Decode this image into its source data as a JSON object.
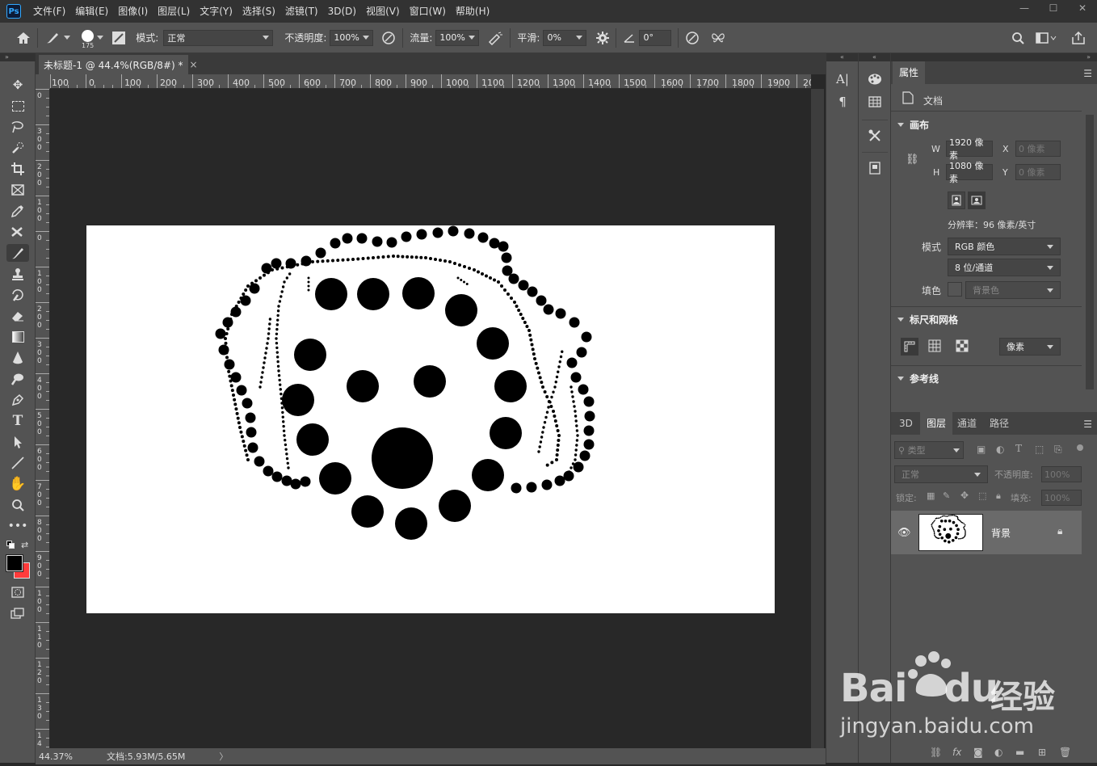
{
  "app": {
    "logo": "Ps"
  },
  "menu": [
    "文件(F)",
    "编辑(E)",
    "图像(I)",
    "图层(L)",
    "文字(Y)",
    "选择(S)",
    "滤镜(T)",
    "3D(D)",
    "视图(V)",
    "窗口(W)",
    "帮助(H)"
  ],
  "window_controls": [
    "—",
    "☐",
    "✕"
  ],
  "options": {
    "brush_size": "175",
    "mode_label": "模式:",
    "mode_value": "正常",
    "opacity_label": "不透明度:",
    "opacity_value": "100%",
    "flow_label": "流量:",
    "flow_value": "100%",
    "smooth_label": "平滑:",
    "smooth_value": "0%",
    "angle_value": "0°"
  },
  "document_tab": {
    "title": "未标题-1 @ 44.4%(RGB/8#) *",
    "close": "×"
  },
  "ruler": {
    "h": [
      "100",
      "0",
      "100",
      "200",
      "300",
      "400",
      "500",
      "600",
      "700",
      "800",
      "900",
      "1000",
      "1100",
      "1200",
      "1300",
      "1400",
      "1500",
      "1600",
      "1700",
      "1800",
      "1900",
      "20"
    ],
    "v": [
      "0",
      "3 0 0",
      "2 0 0",
      "1 0 0",
      "0",
      "1 0 0",
      "2 0 0",
      "3 0 0",
      "4 0 0",
      "5 0 0",
      "6 0 0",
      "7 0 0",
      "8 0 0",
      "9 0 0",
      "1 0 0",
      "1 1 0",
      "1 2 0",
      "1 3 0",
      "1 4"
    ]
  },
  "status": {
    "zoom": "44.37%",
    "doc_info": "文档:5.93M/5.65M",
    "arrow": "〉"
  },
  "panels": {
    "mini1_icons": [
      "character-icon",
      "paragraph-icon"
    ],
    "mini2_icons": [
      "color-palette-icon",
      "table-icon",
      "tools-icon",
      "book-icon"
    ]
  },
  "properties": {
    "tab": "属性",
    "doc_label": "文档",
    "canvas_title": "画布",
    "w_label": "W",
    "w_value": "1920 像素",
    "h_label": "H",
    "h_value": "1080 像素",
    "x_label": "X",
    "x_value": "0 像素",
    "y_label": "Y",
    "y_value": "0 像素",
    "resolution": "分辨率：96 像素/英寸",
    "mode_label": "模式",
    "mode_value": "RGB 颜色",
    "depth_value": "8 位/通道",
    "fill_label": "填色",
    "fill_value": "背景色",
    "rulers_title": "标尺和网格",
    "units_value": "像素",
    "guides_title": "参考线"
  },
  "layers": {
    "tabs": [
      "3D",
      "图层",
      "通道",
      "路径"
    ],
    "active_tab": "图层",
    "filter_value": "类型",
    "blend_value": "正常",
    "opacity_label": "不透明度:",
    "opacity_value": "100%",
    "lock_label": "锁定:",
    "fill_label": "填充:",
    "fill_value": "100%",
    "items": [
      {
        "name": "背景",
        "locked": true,
        "visible": true
      }
    ]
  },
  "watermark": {
    "brand": "Bai",
    "brand_suffix": "du",
    "cn": "经验",
    "url": "jingyan.baidu.com"
  },
  "colors": {
    "foreground": "#000000",
    "background": "#ff3b3b",
    "accent": "#31a8ff"
  }
}
